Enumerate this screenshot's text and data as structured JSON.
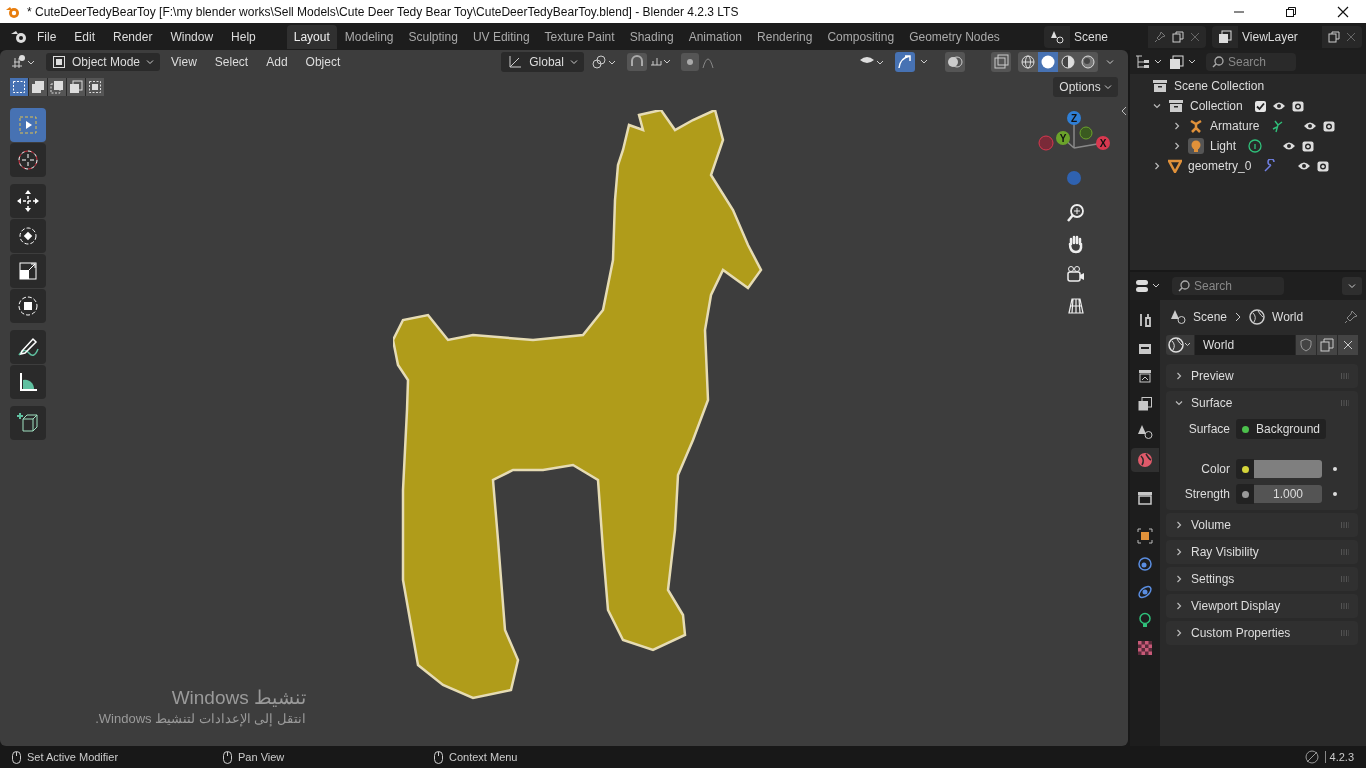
{
  "title_bar": {
    "title": "* CuteDeerTedyBearToy [F:\\my blender works\\Sell Models\\Cute Deer Tedy Bear Toy\\CuteDeerTedyBearToy.blend] - Blender 4.2.3 LTS"
  },
  "menu": [
    "File",
    "Edit",
    "Render",
    "Window",
    "Help"
  ],
  "workspaces": [
    {
      "label": "Layout",
      "selected": true
    },
    {
      "label": "Modeling",
      "selected": false
    },
    {
      "label": "Sculpting",
      "selected": false
    },
    {
      "label": "UV Editing",
      "selected": false
    },
    {
      "label": "Texture Paint",
      "selected": false
    },
    {
      "label": "Shading",
      "selected": false
    },
    {
      "label": "Animation",
      "selected": false
    },
    {
      "label": "Rendering",
      "selected": false
    },
    {
      "label": "Compositing",
      "selected": false
    },
    {
      "label": "Geometry Nodes",
      "selected": false
    }
  ],
  "scene": {
    "value": "Scene"
  },
  "view_layer": {
    "value": "ViewLayer"
  },
  "viewport": {
    "mode": "Object Mode",
    "menus": [
      "View",
      "Select",
      "Add",
      "Object"
    ],
    "orientation": "Global",
    "gizmos_on": true,
    "shading": [
      {
        "kind": "wireframe",
        "selected": false
      },
      {
        "kind": "solid",
        "selected": true
      },
      {
        "kind": "material",
        "selected": false
      },
      {
        "kind": "rendered",
        "selected": false
      }
    ],
    "options": "Options",
    "select_modes": [
      {
        "kind": "set",
        "selected": true
      },
      {
        "kind": "extend",
        "selected": false
      },
      {
        "kind": "subtract",
        "selected": false
      },
      {
        "kind": "invert",
        "selected": false
      },
      {
        "kind": "intersect",
        "selected": false
      }
    ],
    "tools": [
      {
        "kind": "select_box",
        "selected": true
      },
      {
        "kind": "cursor",
        "selected": false
      },
      {
        "kind": "move",
        "selected": false
      },
      {
        "kind": "rotate",
        "selected": false
      },
      {
        "kind": "scale",
        "selected": false
      },
      {
        "kind": "transform",
        "selected": false
      },
      {
        "kind": "annotate",
        "selected": false
      },
      {
        "kind": "measure",
        "selected": false
      },
      {
        "kind": "add_cube",
        "selected": false
      }
    ],
    "gizmo": {
      "axes": [
        {
          "label": "Z",
          "color": "#2f7fd6"
        },
        {
          "label": "Y",
          "color": "#6ba32a"
        },
        {
          "label": "X",
          "color": "#d8384f"
        }
      ]
    }
  },
  "outliner": {
    "search": {
      "placeholder": "Search"
    },
    "tree": {
      "label": "Scene Collection",
      "children": [
        {
          "label": "Collection",
          "kind": "collection",
          "expanded": true,
          "checked": true,
          "children": [
            {
              "label": "Armature",
              "kind": "armature",
              "expanded": false
            },
            {
              "label": "Light",
              "kind": "light",
              "expanded": false
            }
          ]
        },
        {
          "label": "geometry_0",
          "kind": "mesh",
          "expanded": false
        }
      ]
    }
  },
  "properties": {
    "search": {
      "placeholder": "Search"
    },
    "tabs": [
      {
        "kind": "tool",
        "selected": false
      },
      {
        "kind": "render",
        "selected": false
      },
      {
        "kind": "output",
        "selected": false
      },
      {
        "kind": "view_layer",
        "selected": false
      },
      {
        "kind": "scene",
        "selected": false
      },
      {
        "kind": "world",
        "selected": true
      },
      {
        "kind": "collection",
        "selected": false
      },
      {
        "kind": "object",
        "selected": false
      },
      {
        "kind": "physics",
        "selected": false
      },
      {
        "kind": "constraints",
        "selected": false
      },
      {
        "kind": "data",
        "selected": false
      },
      {
        "kind": "texture",
        "selected": false
      }
    ],
    "breadcrumb": [
      "Scene",
      "World"
    ],
    "datablock": "World",
    "panels": [
      {
        "label": "Preview",
        "expanded": false
      },
      {
        "label": "Surface",
        "expanded": true,
        "fields": [
          {
            "label": "Surface",
            "kind": "shader",
            "value": "Background",
            "color": "#4cc04c"
          },
          {
            "label": "Color",
            "kind": "color",
            "color": "#d4d43a"
          },
          {
            "label": "Strength",
            "kind": "number",
            "value": "1.000",
            "color": "#9a9a9a"
          }
        ]
      },
      {
        "label": "Volume",
        "expanded": false
      },
      {
        "label": "Ray Visibility",
        "expanded": false
      },
      {
        "label": "Settings",
        "expanded": false
      },
      {
        "label": "Viewport Display",
        "expanded": false
      },
      {
        "label": "Custom Properties",
        "expanded": false
      }
    ]
  },
  "activation_notice": {
    "title": "تنشيط Windows",
    "message": "انتقل إلى الإعدادات لتنشيط Windows."
  },
  "status_bar": {
    "hints": [
      "Set Active Modifier",
      "Pan View",
      "Context Menu"
    ],
    "version": "4.2.3"
  }
}
